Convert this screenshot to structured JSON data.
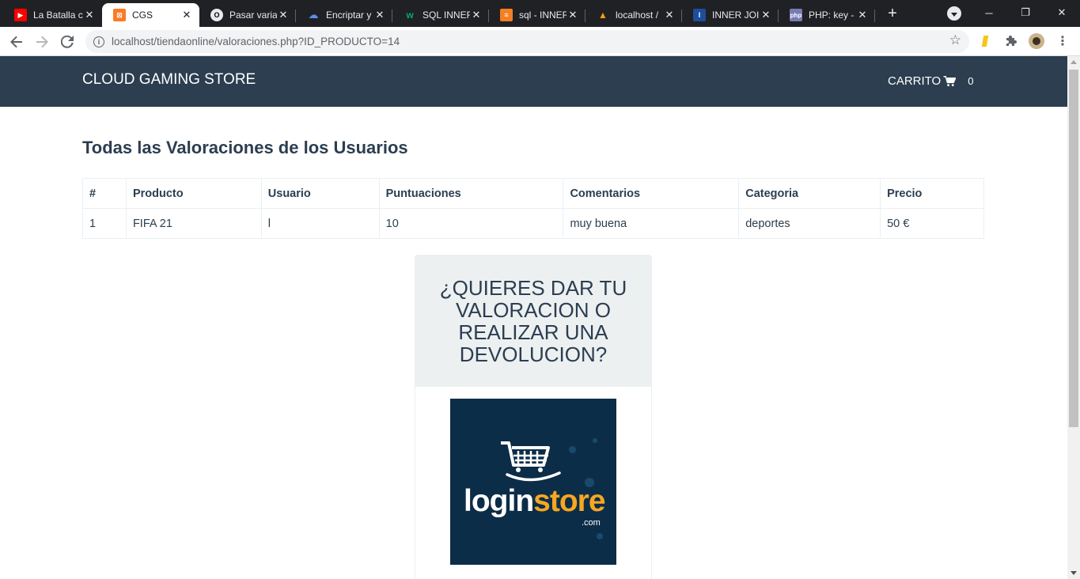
{
  "browser": {
    "tabs": [
      {
        "title": "La Batalla c",
        "icon": "youtube-icon",
        "color": "#ff0000"
      },
      {
        "title": "CGS",
        "icon": "xampp-icon",
        "color": "#fb7a24",
        "active": true
      },
      {
        "title": "Pasar varial",
        "icon": "ring-icon",
        "color": "#000000"
      },
      {
        "title": "Encriptar y",
        "icon": "cloud-icon",
        "color": "#5b8def"
      },
      {
        "title": "SQL INNER",
        "icon": "w3schools-icon",
        "color": "#04aa6d"
      },
      {
        "title": "sql - INNER",
        "icon": "stackoverflow-icon",
        "color": "#f48024"
      },
      {
        "title": "localhost /",
        "icon": "phpmyadmin-icon",
        "color": "#f89c0e"
      },
      {
        "title": "INNER JOIN",
        "icon": "bookmark-icon",
        "color": "#1d4e9c"
      },
      {
        "title": "PHP: key -",
        "icon": "php-icon",
        "color": "#777bb3"
      }
    ],
    "url": "localhost/tiendaonline/valoraciones.php?ID_PRODUCTO=14"
  },
  "navbar": {
    "brand": "CLOUD GAMING STORE",
    "cart_label": "CARRITO",
    "cart_count": "0"
  },
  "page": {
    "heading": "Todas las Valoraciones de los Usuarios",
    "table": {
      "headers": [
        "#",
        "Producto",
        "Usuario",
        "Puntuaciones",
        "Comentarios",
        "Categoria",
        "Precio"
      ],
      "rows": [
        [
          "1",
          "FIFA 21",
          "l",
          "10",
          "muy buena",
          "deportes",
          "50 €"
        ]
      ]
    },
    "panel": {
      "title": "¿QUIERES DAR TU VALORACION O REALIZAR UNA DEVOLUCION?",
      "logo_text_a": "login",
      "logo_text_b": "store",
      "logo_suffix": ".com"
    }
  }
}
